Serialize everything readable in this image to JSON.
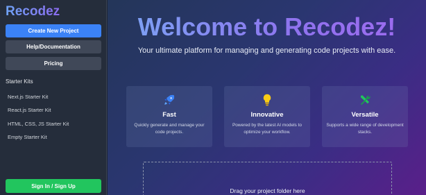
{
  "sidebar": {
    "logo": "Recodez",
    "buttons": {
      "create": "Create New Project",
      "help": "Help/Documentation",
      "pricing": "Pricing",
      "signin": "Sign In / Sign Up"
    },
    "kits_title": "Starter Kits",
    "kits": [
      "Next.js Starter Kit",
      "React.js Starter Kit",
      "HTML, CSS, JS Starter Kit",
      "Empty Starter Kit"
    ]
  },
  "main": {
    "title": "Welcome to Recodez!",
    "subtitle": "Your ultimate platform for managing and generating code projects with ease.",
    "features": [
      {
        "icon": "rocket-icon",
        "title": "Fast",
        "desc": "Quickly generate and manage your code projects."
      },
      {
        "icon": "lightbulb-icon",
        "title": "Innovative",
        "desc": "Powered by the latest AI models to optimize your workflow."
      },
      {
        "icon": "tools-icon",
        "title": "Versatile",
        "desc": "Supports a wide range of development stacks."
      }
    ],
    "dropzone_text": "Drag your project folder here"
  },
  "colors": {
    "primary": "#3b82f6",
    "success": "#22c55e",
    "rocket": "#3b82f6",
    "bulb": "#facc15",
    "tools": "#22c55e"
  }
}
